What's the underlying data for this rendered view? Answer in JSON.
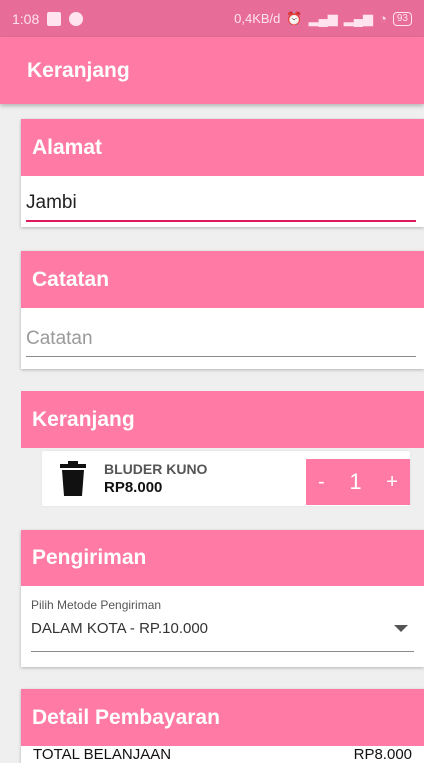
{
  "status_bar": {
    "time": "1:08",
    "net_speed": "0,4KB/d",
    "battery": "93"
  },
  "app_bar": {
    "title": "Keranjang"
  },
  "alamat": {
    "header": "Alamat",
    "value": "Jambi"
  },
  "catatan": {
    "header": "Catatan",
    "placeholder": "Catatan",
    "value": ""
  },
  "keranjang": {
    "header": "Keranjang",
    "items": [
      {
        "name": "BLUDER KUNO",
        "price": "RP8.000",
        "qty": "1",
        "minus": "-",
        "plus": "+"
      }
    ]
  },
  "pengiriman": {
    "header": "Pengiriman",
    "label": "Pilih Metode Pengiriman",
    "selected": "DALAM KOTA - RP.10.000"
  },
  "pembayaran": {
    "header": "Detail Pembayaran",
    "total_label": "TOTAL BELANJAAN",
    "total_value": "RP8.000"
  },
  "colors": {
    "primary": "#ff7aa5",
    "status_bar": "#e86c98",
    "accent_underline": "#e0195c",
    "background": "#efefef"
  }
}
